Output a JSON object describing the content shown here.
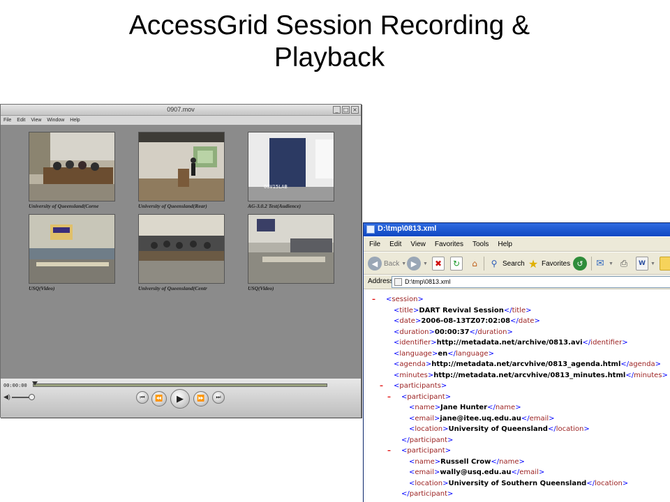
{
  "slide": {
    "title_line1": "AccessGrid Session Recording &",
    "title_line2": "Playback"
  },
  "quicktime": {
    "window_title": "0907.mov",
    "window_buttons": [
      "_",
      "□",
      "×"
    ],
    "menu": [
      "File",
      "Edit",
      "View",
      "Window",
      "Help"
    ],
    "tiles": [
      {
        "caption": "University of Queensland(Corne"
      },
      {
        "caption": "University of Queensland(Rear)"
      },
      {
        "caption": "AG-3.0.2 Test(Audience)",
        "overlay": "00V15LAB"
      },
      {
        "caption": "USQ(Video)"
      },
      {
        "caption": "University of Queensland(Centr"
      },
      {
        "caption": "USQ(Video)"
      }
    ],
    "time": "00:00:00",
    "progress": 0,
    "volume": 0.8,
    "transport": {
      "prev_icon": "⏮",
      "rewind_icon": "⏪",
      "play_icon": "▶",
      "forward_icon": "⏩",
      "next_icon": "⏭"
    }
  },
  "browser": {
    "title": "D:\\tmp\\0813.xml",
    "menu": [
      "File",
      "Edit",
      "View",
      "Favorites",
      "Tools",
      "Help"
    ],
    "toolbar": {
      "back_label": "Back",
      "search_label": "Search",
      "favorites_label": "Favorites"
    },
    "address_label": "Address",
    "address_value": "D:\\tmp\\0813.xml",
    "xml_lines": [
      {
        "minus": "–",
        "text": "<session>",
        "indent": 0
      },
      {
        "open": "title",
        "value": "DART Revival Session",
        "indent": 1
      },
      {
        "open": "date",
        "value": "2006-08-13TZ07:02:08",
        "indent": 1
      },
      {
        "open": "duration",
        "value": "00:00:37",
        "indent": 1
      },
      {
        "open": "identifier",
        "value": "http://metadata.net/archive/0813.avi",
        "indent": 1
      },
      {
        "open": "language",
        "value": "en",
        "indent": 1
      },
      {
        "open": "agenda",
        "value": "http://metadata.net/arcvhive/0813_agenda.html",
        "indent": 1
      },
      {
        "open": "minutes",
        "value": "http://metadata.net/arcvhive/0813_minutes.html",
        "indent": 1
      },
      {
        "minus": "–",
        "text": "<participants>",
        "indent": 1
      },
      {
        "minus": "–",
        "text": "<participant>",
        "indent": 2
      },
      {
        "open": "name",
        "value": "Jane Hunter",
        "indent": 3
      },
      {
        "open": "email",
        "value": "jane@itee.uq.edu.au",
        "indent": 3
      },
      {
        "open": "location",
        "value": "University of Queensland",
        "indent": 3
      },
      {
        "text": "</participant>",
        "indent": 2
      },
      {
        "minus": "–",
        "text": "<participant>",
        "indent": 2
      },
      {
        "open": "name",
        "value": "Russell Crow",
        "indent": 3
      },
      {
        "open": "email",
        "value": "wally@usq.edu.au",
        "indent": 3
      },
      {
        "open": "location",
        "value": "University of Southern Queensland",
        "indent": 3
      },
      {
        "text": "</participant>",
        "indent": 2
      }
    ]
  }
}
